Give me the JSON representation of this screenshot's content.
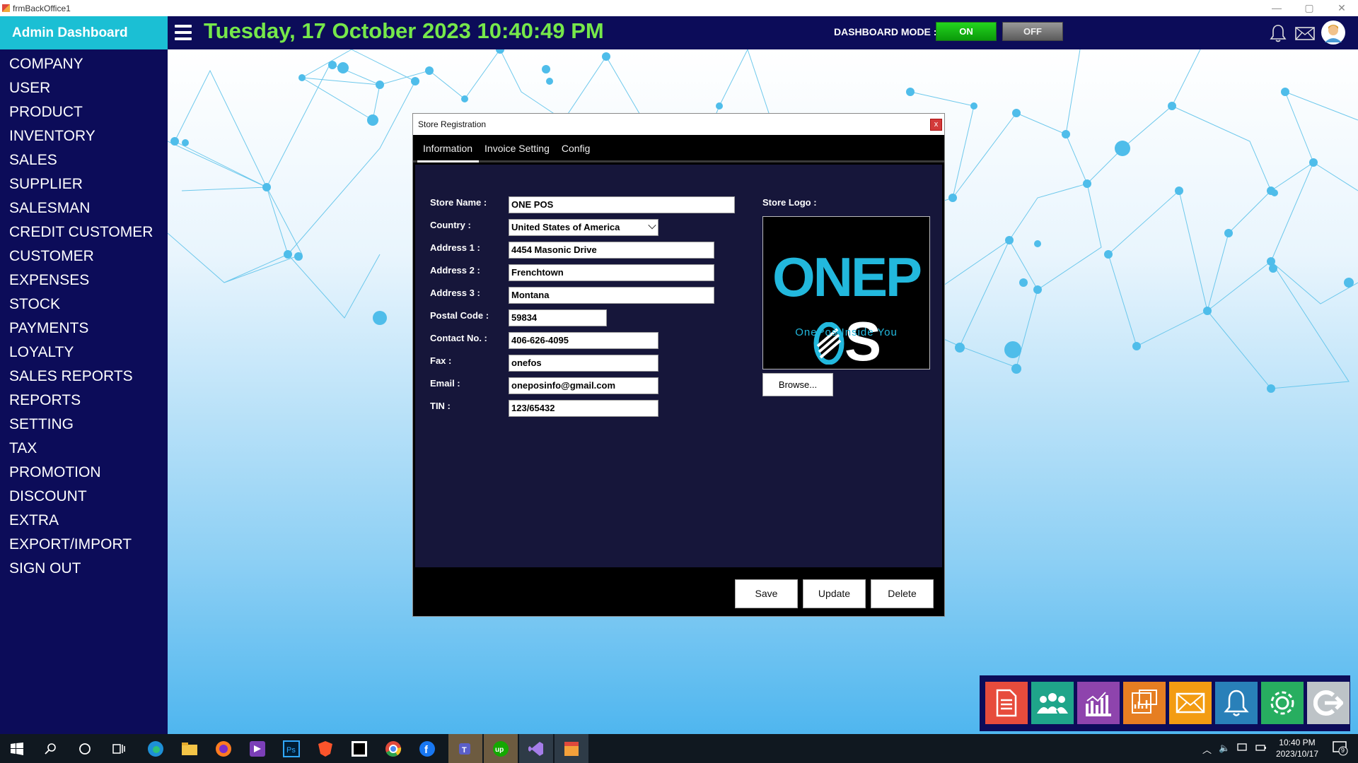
{
  "window": {
    "title": "frmBackOffice1"
  },
  "sidebar": {
    "header": "Admin Dashboard",
    "items": [
      "COMPANY",
      "USER",
      "PRODUCT",
      "INVENTORY",
      "SALES",
      "SUPPLIER",
      "SALESMAN",
      "CREDIT CUSTOMER",
      "CUSTOMER",
      "EXPENSES",
      "STOCK",
      "PAYMENTS",
      "LOYALTY",
      "SALES REPORTS",
      "REPORTS",
      "SETTING",
      "TAX",
      "PROMOTION",
      "DISCOUNT",
      "EXTRA",
      "EXPORT/IMPORT",
      "SIGN OUT"
    ]
  },
  "topbar": {
    "datetime": "Tuesday, 17 October 2023 10:40:49 PM",
    "dashboard_mode_label": "DASHBOARD MODE :",
    "mode_on": "ON",
    "mode_off": "OFF",
    "mode_selected": "ON",
    "icons": [
      "bell-icon",
      "mail-icon",
      "user-avatar"
    ]
  },
  "dialog": {
    "title": "Store Registration",
    "close": "x",
    "tabs": [
      "Information",
      "Invoice Setting",
      "Config"
    ],
    "active_tab": "Information",
    "labels": {
      "store_name": "Store Name :",
      "country": "Country :",
      "address1": "Address 1 :",
      "address2": "Address 2 :",
      "address3": "Address 3 :",
      "postal": "Postal Code :",
      "contact": "Contact No. :",
      "fax": "Fax :",
      "email": "Email :",
      "tin": "TIN :",
      "logo": "Store Logo :"
    },
    "values": {
      "store_name": "ONE POS",
      "country": "United States of America",
      "address1": "4454 Masonic Drive",
      "address2": "Frenchtown",
      "address3": "Montana",
      "postal": "59834",
      "contact": "406-626-4095",
      "fax": "onefos",
      "email": "oneposinfo@gmail.com",
      "tin": "123/65432"
    },
    "logo": {
      "part1": "ONEP",
      "part2": "S",
      "tagline": "OnePos Inside You"
    },
    "browse": "Browse...",
    "buttons": {
      "save": "Save",
      "update": "Update",
      "delete": "Delete"
    }
  },
  "quick_launch": [
    "document-icon",
    "users-icon",
    "chart-icon",
    "report-icon",
    "mail-icon",
    "bell-icon",
    "gear-icon",
    "logout-icon"
  ],
  "taskbar": {
    "time": "10:40 PM",
    "date": "2023/10/17",
    "notifications": "9"
  },
  "colors": {
    "navy": "#0c0c59",
    "accent": "#1bbfd4",
    "datetime": "#76e84a"
  }
}
